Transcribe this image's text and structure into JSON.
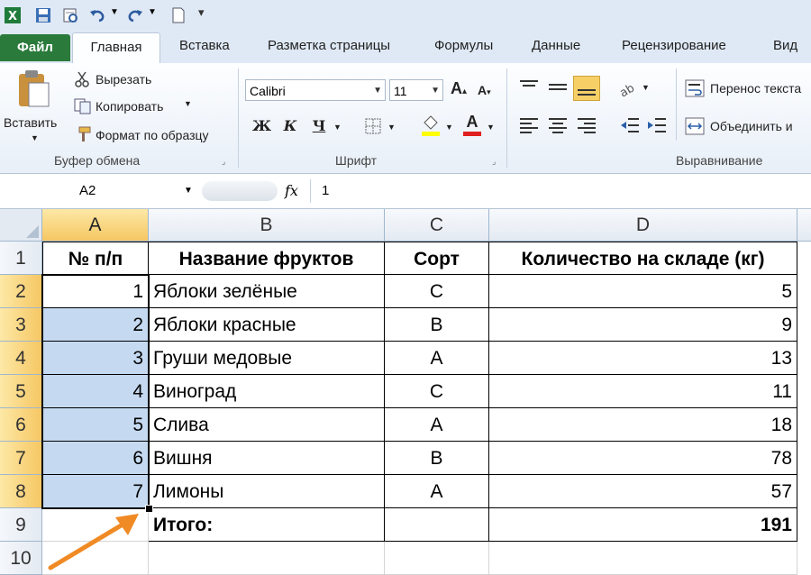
{
  "ribbon_tabs": {
    "file": "Файл",
    "home": "Главная",
    "insert": "Вставка",
    "page_layout": "Разметка страницы",
    "formulas": "Формулы",
    "data": "Данные",
    "review": "Рецензирование",
    "view": "Вид"
  },
  "clipboard": {
    "paste": "Вставить",
    "cut": "Вырезать",
    "copy": "Копировать",
    "format_painter": "Формат по образцу",
    "group": "Буфер обмена"
  },
  "font": {
    "name": "Calibri",
    "size": "11",
    "bold": "Ж",
    "italic": "К",
    "underline": "Ч",
    "group": "Шрифт"
  },
  "alignment": {
    "wrap_text": "Перенос текста",
    "merge": "Объединить и",
    "group": "Выравнивание"
  },
  "formula_bar": {
    "name_box": "A2",
    "fx": "fx",
    "value": "1"
  },
  "columns": [
    "A",
    "B",
    "C",
    "D"
  ],
  "rows": [
    "1",
    "2",
    "3",
    "4",
    "5",
    "6",
    "7",
    "8",
    "9",
    "10"
  ],
  "table": {
    "headers": [
      "№ п/п",
      "Название фруктов",
      "Сорт",
      "Количество на складе (кг)"
    ],
    "data": [
      [
        "1",
        "Яблоки зелёные",
        "C",
        "5"
      ],
      [
        "2",
        "Яблоки красные",
        "B",
        "9"
      ],
      [
        "3",
        "Груши медовые",
        "A",
        "13"
      ],
      [
        "4",
        "Виноград",
        "C",
        "11"
      ],
      [
        "5",
        "Слива",
        "A",
        "18"
      ],
      [
        "6",
        "Вишня",
        "B",
        "78"
      ],
      [
        "7",
        "Лимоны",
        "A",
        "57"
      ]
    ],
    "total_label": "Итого:",
    "total_value": "191"
  },
  "colors": {
    "selection": "#c5daf1",
    "header_selected": "#f6c763",
    "arrow": "#f08a24",
    "file_tab": "#2a7a3b"
  }
}
